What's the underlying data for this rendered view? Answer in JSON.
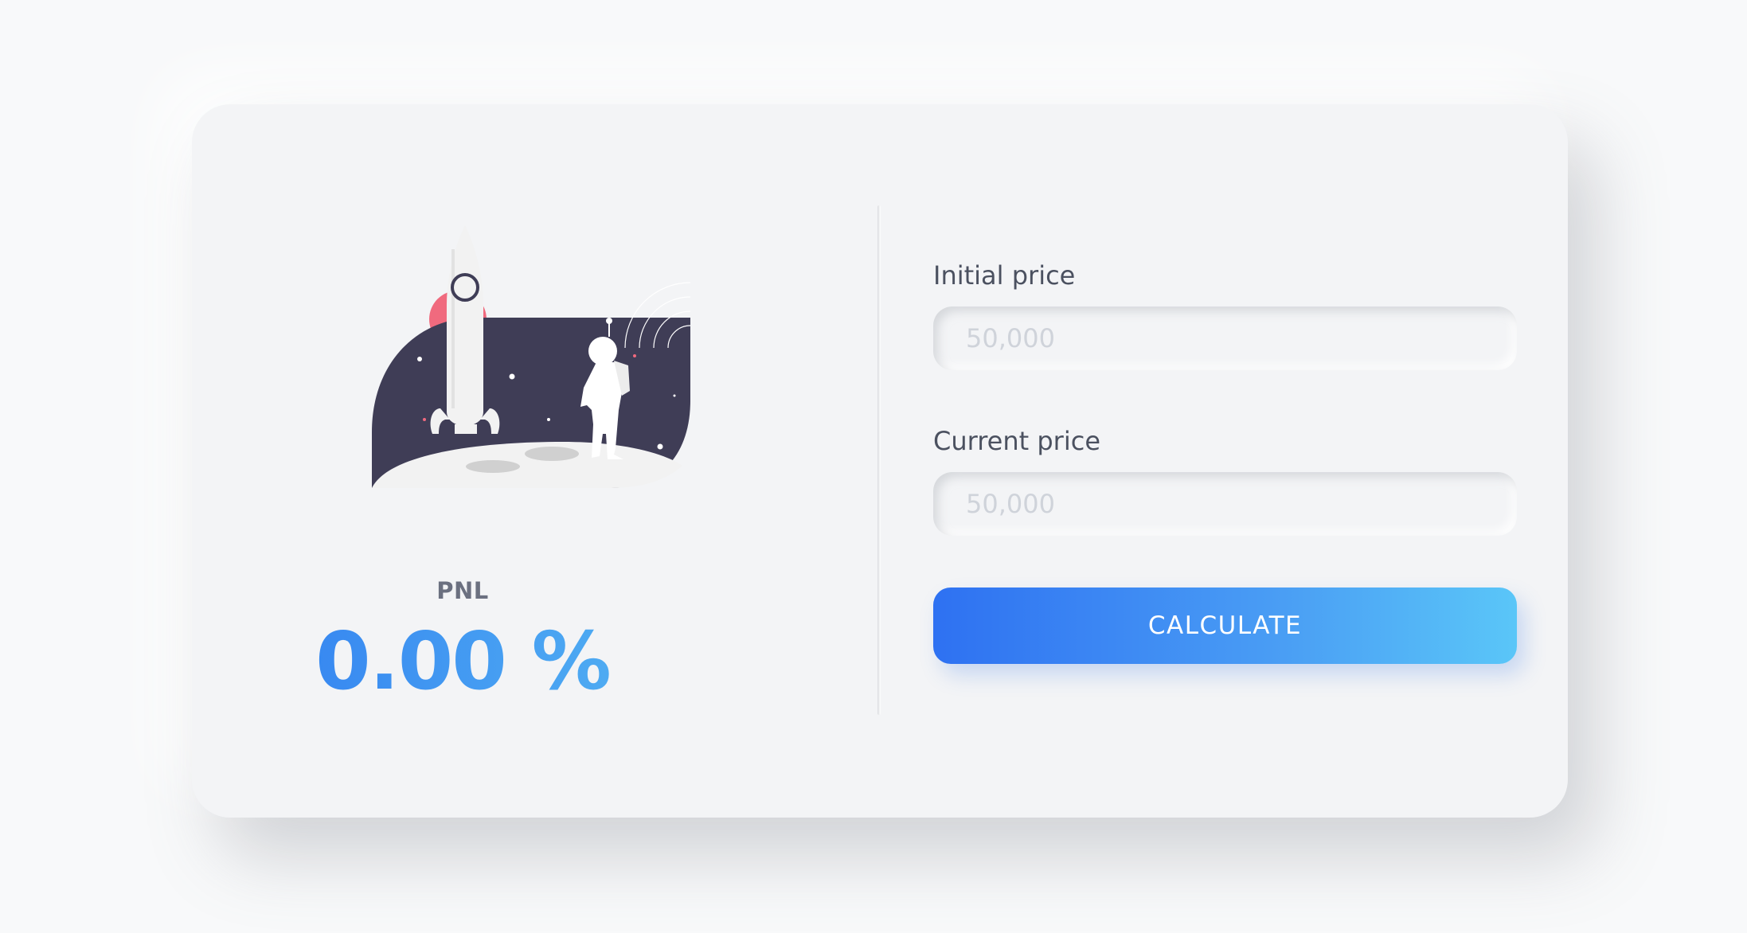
{
  "result": {
    "label": "PNL",
    "value": "0.00 %"
  },
  "form": {
    "initial_price": {
      "label": "Initial price",
      "placeholder": "50,000",
      "value": ""
    },
    "current_price": {
      "label": "Current price",
      "placeholder": "50,000",
      "value": ""
    },
    "calculate_label": "CALCULATE"
  },
  "illustration": {
    "icon": "rocket-astronaut-moon-illustration"
  },
  "colors": {
    "accent_start": "#2e71f2",
    "accent_end": "#5ac6f8",
    "card_background": "#f3f4f6",
    "night_sky": "#3f3d56",
    "planet": "#f06a7e"
  }
}
